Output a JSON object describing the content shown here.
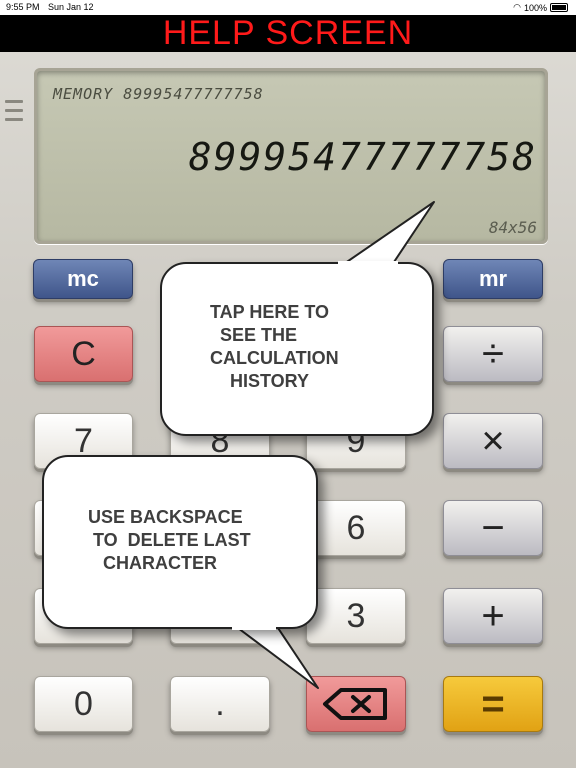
{
  "status": {
    "time": "9:55 PM",
    "date": "Sun Jan 12",
    "battery": "100%"
  },
  "title": "HELP SCREEN",
  "display": {
    "memory_label": "MEMORY 89995477777758",
    "value": "89995477777758",
    "resolution": "84x56"
  },
  "keys": {
    "mc": "mc",
    "mr": "mr",
    "clear": "C",
    "divide": "÷",
    "multiply": "×",
    "minus": "−",
    "plus": "+",
    "equals": "=",
    "zero": "0",
    "dot": ".",
    "seven": "7",
    "eight": "8",
    "nine": "9",
    "six": "6",
    "three": "3"
  },
  "bubbles": {
    "history": "TAP HERE TO\n  SEE THE\nCALCULATION\n    HISTORY",
    "backspace": "USE BACKSPACE\n TO  DELETE LAST\n   CHARACTER"
  },
  "colors": {
    "title": "#ff1a1a",
    "memory_keys": "#3f558a",
    "clear_key": "#d97070",
    "equals_key": "#e1a214"
  }
}
